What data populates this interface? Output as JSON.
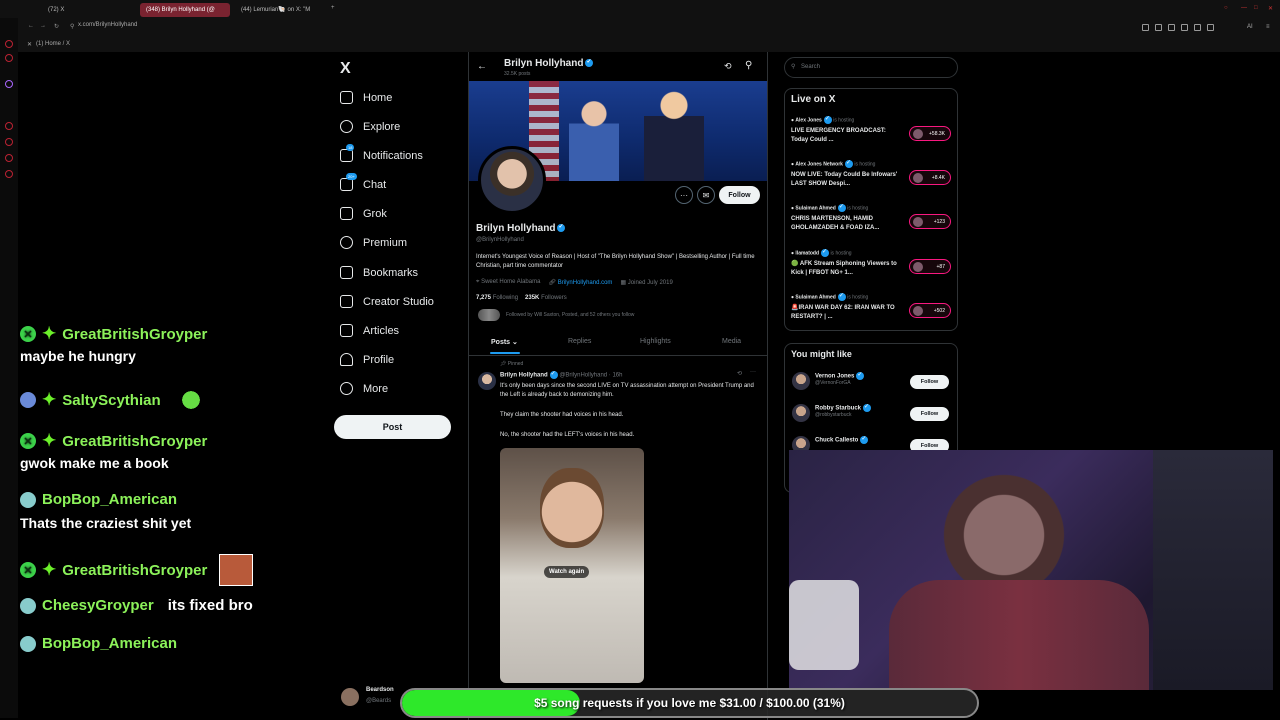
{
  "browser": {
    "tabs": [
      "(72) X",
      "(348) Brilyn Hollyhand (@",
      "(44) Lemurian🐚 on X: \"M"
    ],
    "url": "x.com/BrilynHollyhand",
    "bookmark": "(1) Home / X"
  },
  "x_nav": {
    "logo": "X",
    "items": [
      {
        "label": "Home",
        "icon": "home-icon"
      },
      {
        "label": "Explore",
        "icon": "search-icon"
      },
      {
        "label": "Notifications",
        "icon": "bell-icon",
        "badge": "18"
      },
      {
        "label": "Chat",
        "icon": "chat-icon",
        "badge": "20+"
      },
      {
        "label": "Grok",
        "icon": "grok-icon"
      },
      {
        "label": "Premium",
        "icon": "premium-icon"
      },
      {
        "label": "Bookmarks",
        "icon": "bookmark-icon"
      },
      {
        "label": "Creator Studio",
        "icon": "rocket-icon"
      },
      {
        "label": "Articles",
        "icon": "articles-icon"
      },
      {
        "label": "Profile",
        "icon": "person-icon"
      },
      {
        "label": "More",
        "icon": "more-icon"
      }
    ],
    "post_label": "Post"
  },
  "profile": {
    "header_name": "Brilyn Hollyhand",
    "posts_count": "32.5K posts",
    "name": "Brilyn Hollyhand",
    "handle": "@BrilynHollyhand",
    "bio": "Internet's Youngest Voice of Reason | Host of \"The Brilyn Hollyhand Show\" | Bestselling Author | Full time Christian, part time commentator",
    "location": "Sweet Home Alabama",
    "website": "BrilynHollyhand.com",
    "joined": "Joined July 2019",
    "following_count": "7,275",
    "following_label": "Following",
    "followers_count": "235K",
    "followers_label": "Followers",
    "followed_by": "Followed by Will Saxton, Posted, and 52 others you follow",
    "follow_label": "Follow",
    "tabs": [
      "Posts",
      "Replies",
      "Highlights",
      "Media"
    ]
  },
  "tweet": {
    "pinned": "Pinned",
    "name": "Brilyn Hollyhand",
    "handle": "@BrilynHollyhand · 16h",
    "line1": "It's only been days since the second LIVE on TV assassination attempt on President Trump and the Left is already back to demonizing him.",
    "line2": "They claim the shooter had voices in his head.",
    "line3": "No, the shooter had the LEFT's voices in his head.",
    "watch_again": "Watch again"
  },
  "right": {
    "search_placeholder": "Search",
    "live_title": "Live on X",
    "live": [
      {
        "host": "Alex Jones",
        "status": "is hosting",
        "title": "LIVE EMERGENCY BROADCAST: Today Could ...",
        "count": "+58.3K"
      },
      {
        "host": "Alex Jones Network",
        "status": "is hosting",
        "title": "NOW LIVE: Today Could Be Infowars' LAST SHOW Despi...",
        "count": "+8.4K"
      },
      {
        "host": "Sulaiman Ahmed",
        "status": "is hosting",
        "title": "CHRIS MARTENSON, HAMID GHOLAMZADEH & FOAD IZA...",
        "count": "+123"
      },
      {
        "host": "llamatodd",
        "status": "is hosting",
        "title": "🟢 AFK Stream Siphoning Viewers to Kick | FFBOT NG+ 1...",
        "count": "+87"
      },
      {
        "host": "Sulaiman Ahmed",
        "status": "is hosting",
        "title": "🚨IRAN WAR DAY 62: IRAN WAR TO RESTART? | ...",
        "count": "+502"
      }
    ],
    "like_title": "You might like",
    "suggestions": [
      {
        "name": "Vernon Jones",
        "handle": "@VernonForGA"
      },
      {
        "name": "Robby Starbuck",
        "handle": "@robbystarbuck"
      },
      {
        "name": "Chuck Callesto",
        "handle": ""
      }
    ],
    "follow_label": "Follow"
  },
  "chat": [
    {
      "user": "GreatBritishGroyper",
      "msg": "maybe he hungry"
    },
    {
      "user": "SaltyScythian",
      "msg": ""
    },
    {
      "user": "GreatBritishGroyper",
      "msg": "gwok make me a book"
    },
    {
      "user": "BopBop_American",
      "msg": "Thats the craziest shit yet"
    },
    {
      "user": "GreatBritishGroyper",
      "msg": ""
    },
    {
      "user": "CheesyGroyper",
      "msg": "its fixed bro"
    },
    {
      "user": "BopBop_American",
      "msg": ""
    }
  ],
  "bottom_user": {
    "name": "Beardson",
    "handle": "@Beards"
  },
  "goal": {
    "text": "$5 song requests if you love me $31.00 / $100.00 (31%)",
    "progress_percent": 31,
    "fill_color": "#2ee82a"
  }
}
